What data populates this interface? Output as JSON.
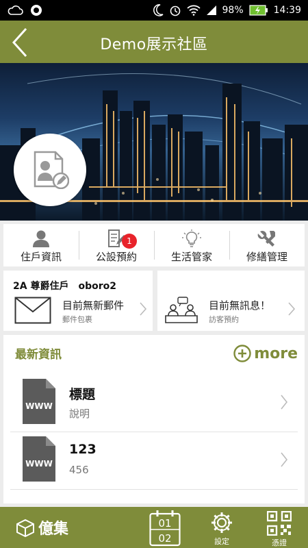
{
  "status_bar": {
    "battery": "98%",
    "time": "14:39"
  },
  "app_bar": {
    "title": "Demo展示社區",
    "back_icon": "chevron-left-icon"
  },
  "nav": [
    {
      "label": "住戶資訊",
      "icon": "person-icon"
    },
    {
      "label": "公設預約",
      "icon": "edit-document-icon",
      "badge": "1"
    },
    {
      "label": "生活管家",
      "icon": "lightbulb-icon"
    },
    {
      "label": "修繕管理",
      "icon": "tools-icon"
    }
  ],
  "card_left": {
    "unit": "2A 尊爵住戶　oboro2",
    "main": "目前無新郵件",
    "sub": "郵件包裹"
  },
  "card_right": {
    "main": "目前無訊息！",
    "sub": "訪客預約"
  },
  "news": {
    "header": "最新資訊",
    "more": "more",
    "items": [
      {
        "title": "標題",
        "desc": "說明",
        "icon_text": "WWW"
      },
      {
        "title": "123",
        "desc": "456",
        "icon_text": "WWW"
      }
    ]
  },
  "bottom": {
    "brand": "億集",
    "calendar": {
      "top": "01",
      "bottom": "02"
    },
    "settings": "設定",
    "qr": "憑證"
  },
  "colors": {
    "primary": "#7f8c3a",
    "badge": "#e8232b"
  }
}
